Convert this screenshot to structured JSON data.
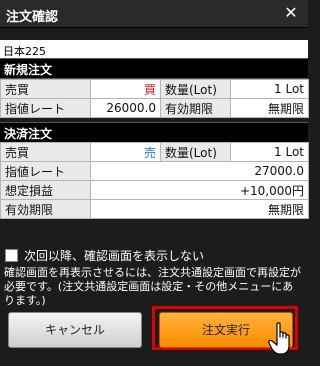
{
  "window": {
    "title": "注文確認"
  },
  "instrument": "日本225",
  "new_order": {
    "header": "新規注文",
    "row1": {
      "label1": "売買",
      "value1": "買",
      "label2": "数量(Lot)",
      "value2": "1 Lot"
    },
    "row2": {
      "label1": "指値レート",
      "value1": "26000.0",
      "label2": "有効期限",
      "value2": "無期限"
    }
  },
  "settlement": {
    "header": "決済注文",
    "row1": {
      "label1": "売買",
      "value1": "売",
      "label2": "数量(Lot)",
      "value2": "1 Lot"
    },
    "rate": {
      "label": "指値レート",
      "value": "27000.0"
    },
    "pl": {
      "label": "想定損益",
      "value": "+10,000円"
    },
    "expiry": {
      "label": "有効期限",
      "value": "無期限"
    }
  },
  "checkbox": {
    "label": "次回以降、確認画面を表示しない",
    "checked": false
  },
  "note": "確認画面を再表示させるには、注文共通設定画面で再設定が必要です。(注文共通設定画面は設定・その他メニューにあります。)",
  "buttons": {
    "cancel": "キャンセル",
    "execute": "注文実行"
  },
  "colors": {
    "buy": "#e0202a",
    "sell": "#1e7be6",
    "accent": "#ff9a00",
    "highlight": "#e00000"
  }
}
